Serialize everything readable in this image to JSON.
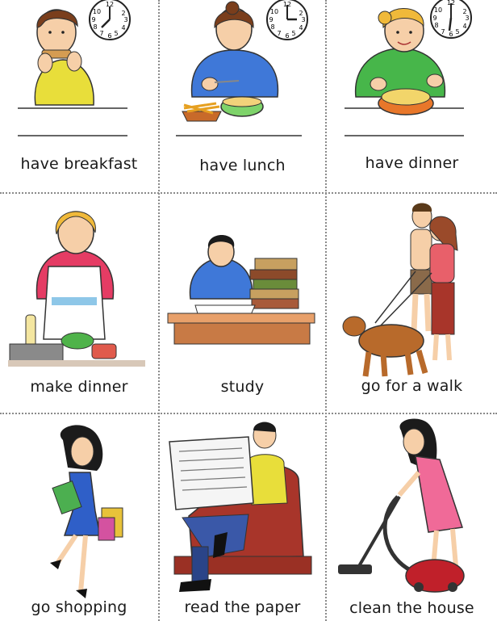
{
  "cards": [
    {
      "label": "have breakfast",
      "clock": {
        "twelve": "12",
        "one": "1",
        "two": "2",
        "three": "3",
        "four": "4",
        "five": "5",
        "six": "6",
        "seven": "7",
        "eight": "8",
        "nine": "9",
        "ten": "10",
        "eleven": "11"
      }
    },
    {
      "label": "have lunch",
      "clock": {
        "twelve": "12",
        "one": "1",
        "two": "2",
        "three": "3",
        "four": "4",
        "five": "5",
        "six": "6",
        "seven": "7",
        "eight": "8",
        "nine": "9",
        "ten": "10",
        "eleven": "11"
      }
    },
    {
      "label": "have dinner",
      "clock": {
        "twelve": "12",
        "one": "1",
        "two": "2",
        "three": "3",
        "four": "4",
        "five": "5",
        "six": "6",
        "seven": "7",
        "eight": "8",
        "nine": "9",
        "ten": "10",
        "eleven": "11"
      }
    },
    {
      "label": "make dinner"
    },
    {
      "label": "study"
    },
    {
      "label": "go for a walk"
    },
    {
      "label": "go shopping"
    },
    {
      "label": "read the paper"
    },
    {
      "label": "clean the house"
    }
  ],
  "colors": {
    "divider": "#8a8a8a",
    "skin": "#f6cfa8",
    "hair_brown": "#7a3e1c",
    "hair_blonde": "#f0b93a",
    "hair_black": "#1b1b1b",
    "shirt_yellow": "#e8de3a",
    "shirt_blue": "#3f78d8",
    "shirt_green": "#47b64a",
    "dress_blue": "#2f5fc8",
    "dress_pink": "#f06a98",
    "armchair_red": "#a8352a",
    "dog_brown": "#b86a2b",
    "table_wood": "#e8a06a"
  }
}
